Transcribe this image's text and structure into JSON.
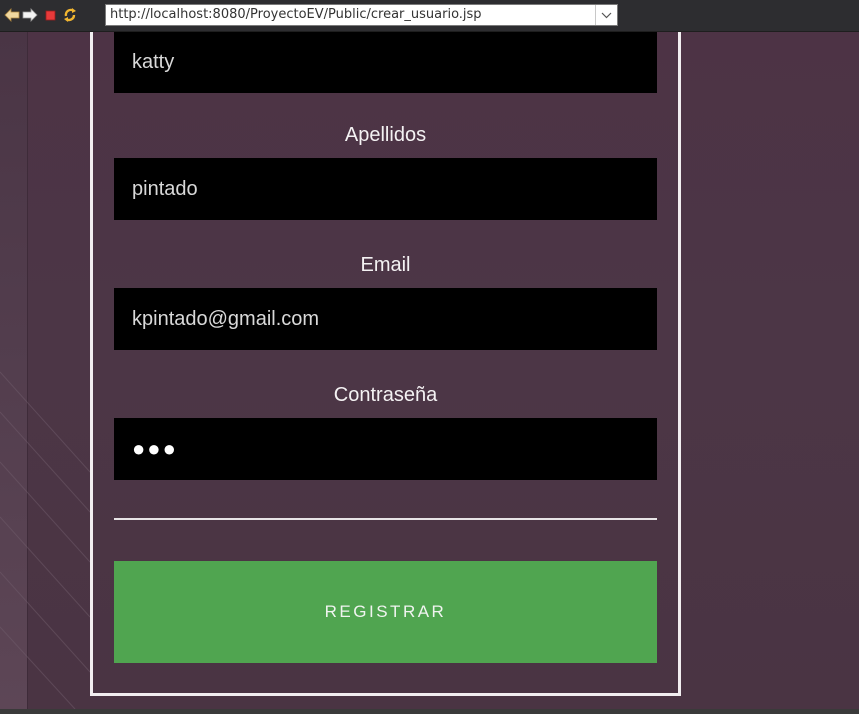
{
  "browser": {
    "url": "http://localhost:8080/ProyectoEV/Public/crear_usuario.jsp",
    "icons": {
      "back": "back-arrow-icon",
      "forward": "forward-arrow-icon",
      "stop": "stop-icon",
      "refresh": "refresh-icon",
      "dropdown": "chevron-down-icon"
    }
  },
  "form": {
    "nombre_value": "katty",
    "apellidos_label": "Apellidos",
    "apellidos_value": "pintado",
    "email_label": "Email",
    "email_value": "kpintado@gmail.com",
    "password_label": "Contraseña",
    "password_value": "●●●",
    "submit_label": "REGISTRAR"
  },
  "colors": {
    "page_background": "#4c3646",
    "field_background": "#000000",
    "submit_background": "#50a550",
    "panel_border": "#f2eef0",
    "label_text": "#f4f2f3"
  }
}
